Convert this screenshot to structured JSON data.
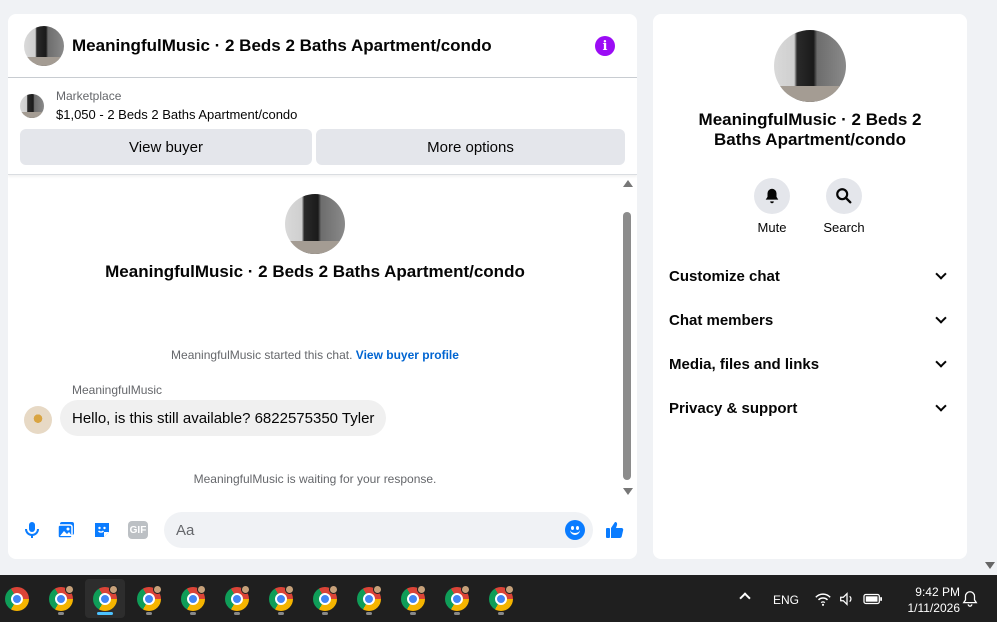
{
  "chat": {
    "title": "MeaningfulMusic · 2 Beds 2 Baths Apartment/condo",
    "listing": {
      "category": "Marketplace",
      "price_title": "$1,050 - 2 Beds 2 Baths Apartment/condo",
      "view_buyer_label": "View buyer",
      "more_options_label": "More options"
    },
    "intro_title": "MeaningfulMusic · 2 Beds 2 Baths Apartment/condo",
    "started_text": "MeaningfulMusic started this chat.",
    "view_profile_link": "View buyer profile",
    "sender_name": "MeaningfulMusic",
    "message_text": "Hello, is this still available? 6822575350 Tyler",
    "waiting_text": "MeaningfulMusic is waiting for your response.",
    "composer": {
      "placeholder": "Aa",
      "value": "",
      "gif_label": "GIF"
    }
  },
  "sidebar": {
    "title": "MeaningfulMusic · 2 Beds 2 Baths Apartment/condo",
    "actions": [
      {
        "label": "Mute",
        "icon": "bell-icon"
      },
      {
        "label": "Search",
        "icon": "search-icon"
      }
    ],
    "sections": [
      {
        "label": "Customize chat"
      },
      {
        "label": "Chat members"
      },
      {
        "label": "Media, files and links"
      },
      {
        "label": "Privacy & support"
      }
    ]
  },
  "taskbar": {
    "language": "ENG",
    "time": "9:42 PM",
    "date": "1/11/2026"
  },
  "colors": {
    "accent_blue": "#0a7cff",
    "info_purple": "#9b0cf5",
    "link_blue": "#0064d1"
  }
}
